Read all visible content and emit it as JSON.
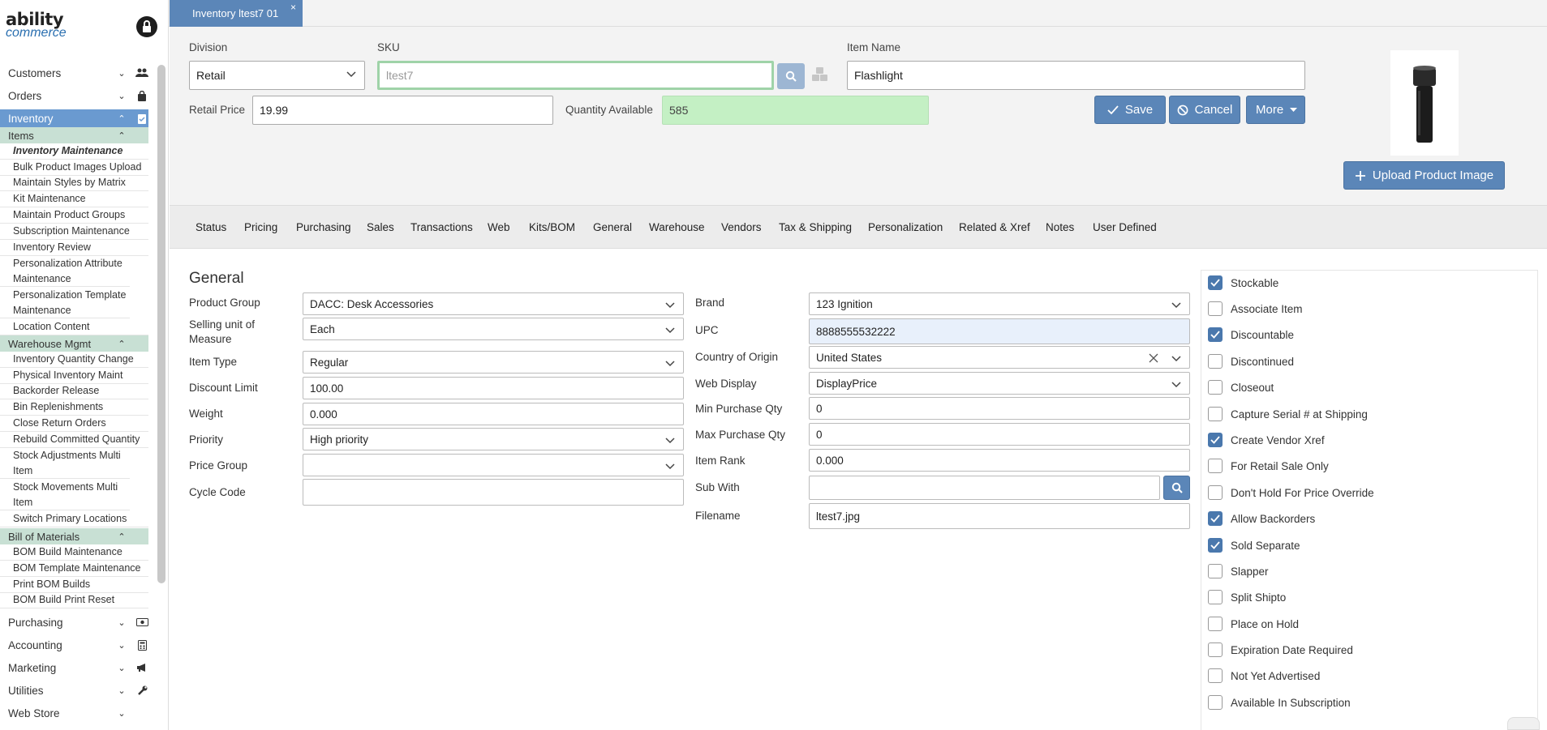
{
  "brand": {
    "line1": "ability",
    "line2": "commerce"
  },
  "sidebar": {
    "nav": [
      {
        "label": "Customers",
        "icon": "users-icon"
      },
      {
        "label": "Orders",
        "icon": "bag-icon"
      },
      {
        "label": "Inventory",
        "icon": "clipboard-icon"
      },
      {
        "label": "Purchasing",
        "icon": "money-icon"
      },
      {
        "label": "Accounting",
        "icon": "calculator-icon"
      },
      {
        "label": "Marketing",
        "icon": "megaphone-icon"
      },
      {
        "label": "Utilities",
        "icon": "wrench-icon"
      },
      {
        "label": "Web Store",
        "icon": ""
      }
    ],
    "sections": [
      {
        "label": "Items",
        "items": [
          "Inventory Maintenance",
          "Bulk Product Images Upload",
          "Maintain Styles by Matrix",
          "Kit Maintenance",
          "Maintain Product Groups",
          "Subscription Maintenance",
          "Inventory Review",
          "Personalization Attribute Maintenance",
          "Personalization Template Maintenance",
          "Location Content"
        ]
      },
      {
        "label": "Warehouse Mgmt",
        "items": [
          "Inventory Quantity Change",
          "Physical Inventory Maint",
          "Backorder Release",
          "Bin Replenishments",
          "Close Return Orders",
          "Rebuild Committed Quantity",
          "Stock Adjustments Multi Item",
          "Stock Movements Multi Item",
          "Switch Primary Locations"
        ]
      },
      {
        "label": "Bill of Materials",
        "items": [
          "BOM Build Maintenance",
          "BOM Template Maintenance",
          "Print BOM Builds",
          "BOM Build Print Reset"
        ]
      }
    ]
  },
  "doc_tab": {
    "label": "Inventory ltest7 01",
    "close": "×"
  },
  "header": {
    "division_label": "Division",
    "division_value": "Retail",
    "sku_label": "SKU",
    "sku_placeholder": "ltest7",
    "item_name_label": "Item Name",
    "item_name_value": "Flashlight",
    "retail_price_label": "Retail Price",
    "retail_price_value": "19.99",
    "qty_label": "Quantity Available",
    "qty_value": "585",
    "save": "Save",
    "cancel": "Cancel",
    "more": "More",
    "upload": "Upload Product Image"
  },
  "tabs": [
    "Status",
    "Pricing",
    "Purchasing",
    "Sales",
    "Transactions",
    "Web",
    "Kits/BOM",
    "General",
    "Warehouse",
    "Vendors",
    "Tax & Shipping",
    "Personalization",
    "Related & Xref",
    "Notes",
    "User Defined"
  ],
  "general": {
    "title": "General",
    "left": [
      {
        "label": "Product Group",
        "value": "DACC: Desk Accessories",
        "dropdown": true
      },
      {
        "label": "Selling unit of Measure",
        "value": "Each",
        "dropdown": true
      },
      {
        "label": "Item Type",
        "value": "Regular",
        "dropdown": true
      },
      {
        "label": "Discount Limit",
        "value": "100.00",
        "dropdown": false
      },
      {
        "label": "Weight",
        "value": "0.000",
        "dropdown": false
      },
      {
        "label": "Priority",
        "value": "High priority",
        "dropdown": true
      },
      {
        "label": "Price Group",
        "value": "",
        "dropdown": true
      },
      {
        "label": "Cycle Code",
        "value": "",
        "dropdown": false
      }
    ],
    "right": [
      {
        "label": "Brand",
        "value": "123 Ignition",
        "dropdown": true
      },
      {
        "label": "UPC",
        "value": "8888555532222",
        "dropdown": false
      },
      {
        "label": "Country of Origin",
        "value": "United States",
        "dropdown": true
      },
      {
        "label": "Web Display",
        "value": "DisplayPrice",
        "dropdown": true
      },
      {
        "label": "Min Purchase Qty",
        "value": "0",
        "dropdown": false
      },
      {
        "label": "Max Purchase Qty",
        "value": "0",
        "dropdown": false
      },
      {
        "label": "Item Rank",
        "value": "0.000",
        "dropdown": false
      },
      {
        "label": "Sub With",
        "value": "",
        "dropdown": false
      },
      {
        "label": "Filename",
        "value": "ltest7.jpg",
        "dropdown": false
      }
    ]
  },
  "checkboxes": [
    {
      "label": "Stockable",
      "checked": true
    },
    {
      "label": "Associate Item",
      "checked": false
    },
    {
      "label": "Discountable",
      "checked": true
    },
    {
      "label": "Discontinued",
      "checked": false
    },
    {
      "label": "Closeout",
      "checked": false
    },
    {
      "label": "Capture Serial # at Shipping",
      "checked": false
    },
    {
      "label": "Create Vendor Xref",
      "checked": true
    },
    {
      "label": "For Retail Sale Only",
      "checked": false
    },
    {
      "label": "Don't Hold For Price Override",
      "checked": false
    },
    {
      "label": "Allow Backorders",
      "checked": true
    },
    {
      "label": "Sold Separate",
      "checked": true
    },
    {
      "label": "Slapper",
      "checked": false
    },
    {
      "label": "Split Shipto",
      "checked": false
    },
    {
      "label": "Place on Hold",
      "checked": false
    },
    {
      "label": "Expiration Date Required",
      "checked": false
    },
    {
      "label": "Not Yet Advertised",
      "checked": false
    },
    {
      "label": "Available In Subscription",
      "checked": false
    }
  ],
  "colors": {
    "accent": "#5b86b8",
    "active_nav": "#6a9ad0",
    "section_bg": "#c8e0d4",
    "qty_bg": "#c4f0c4"
  }
}
